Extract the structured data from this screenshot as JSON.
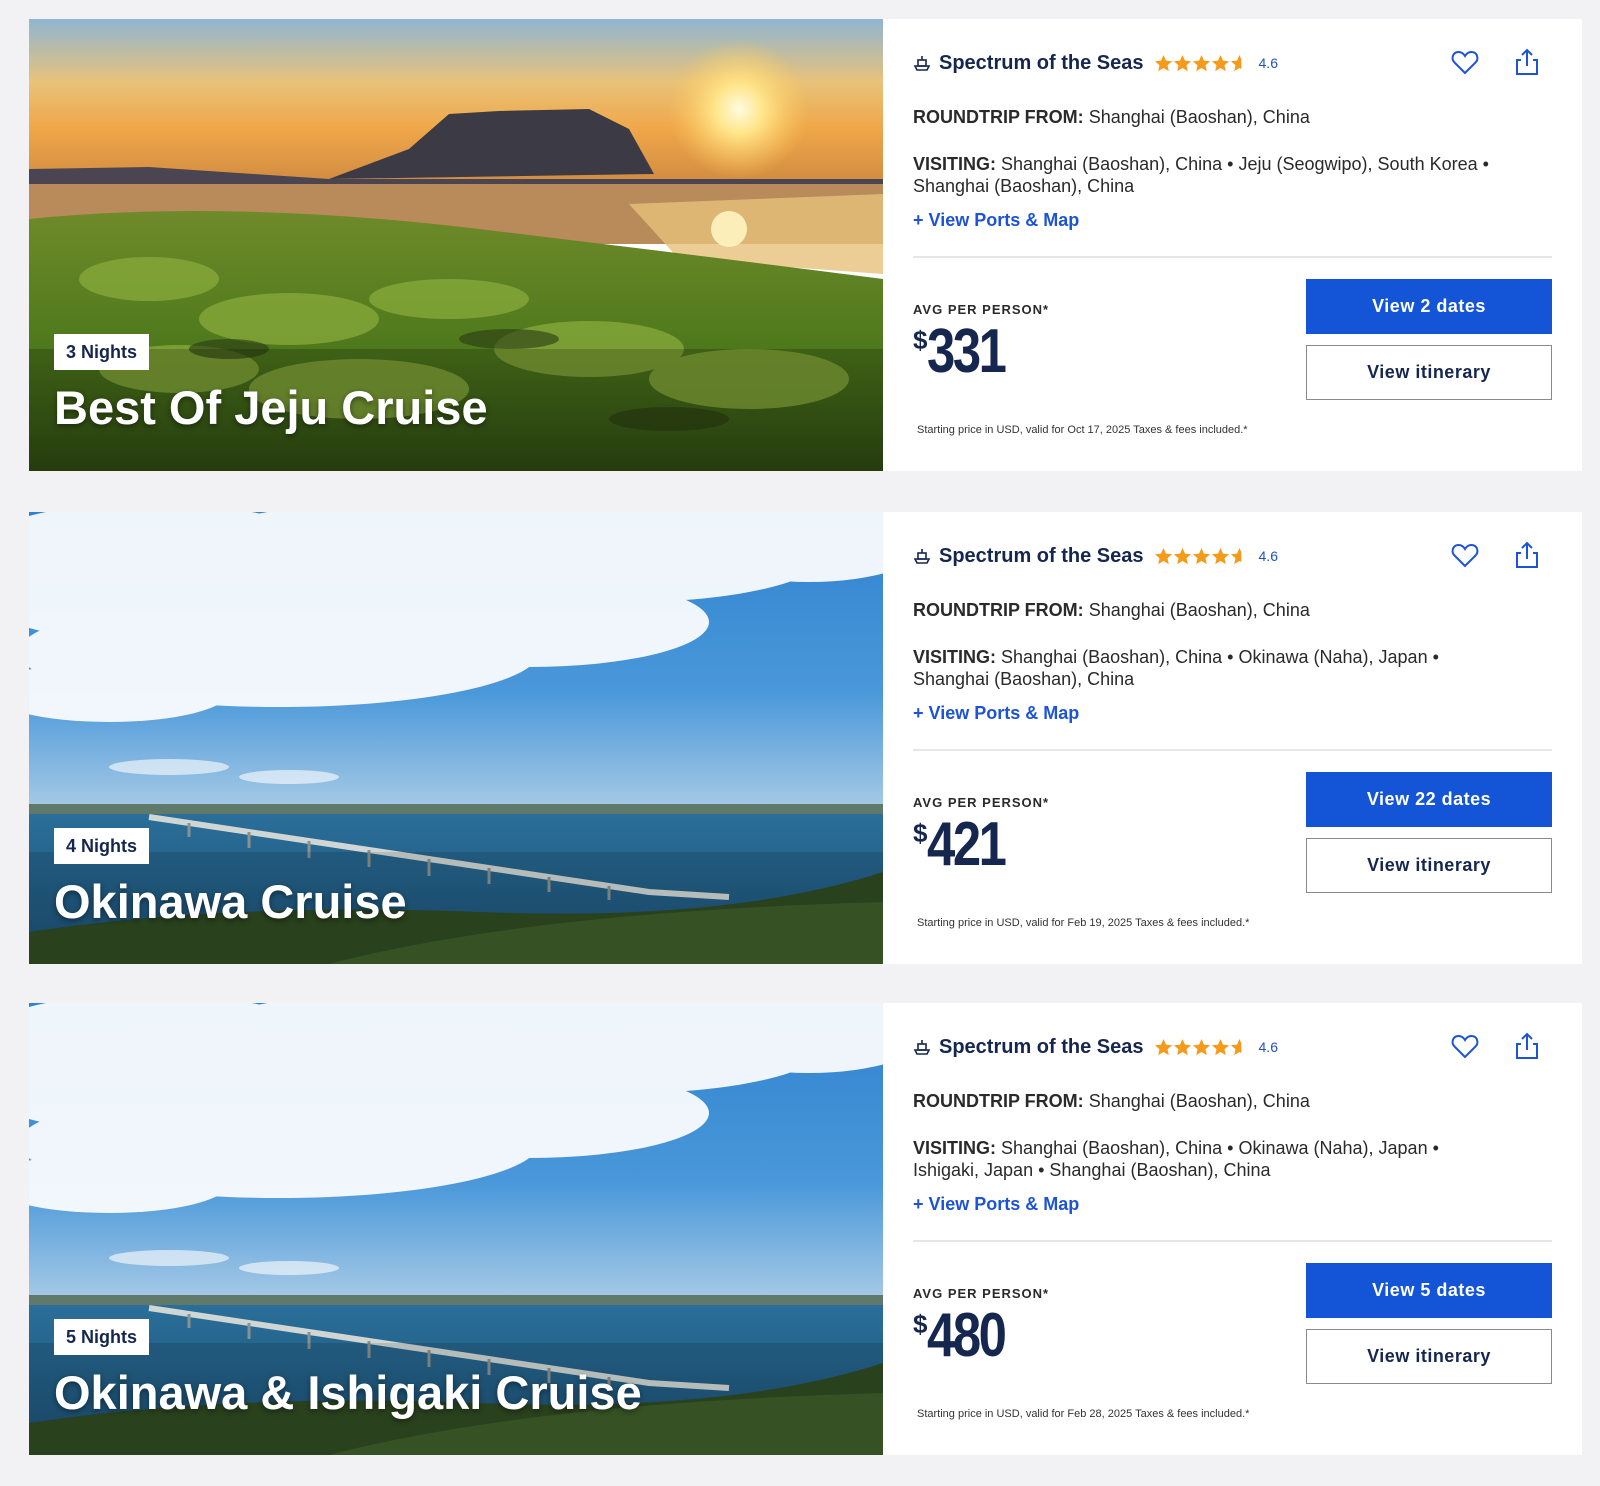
{
  "colors": {
    "brand_navy": "#15264f",
    "primary_blue": "#1455d8",
    "link_blue": "#1d54d6",
    "star_orange": "#f59b1c"
  },
  "cruises": [
    {
      "nights": "3 Nights",
      "title": "Best Of Jeju Cruise",
      "image": "jeju-sunset-coast",
      "ship": "Spectrum of the Seas",
      "rating": "4.6",
      "stars": 4.6,
      "roundtrip_label": "ROUNDTRIP FROM:",
      "roundtrip_value": "Shanghai (Baoshan), China",
      "visiting_label": "VISITING:",
      "visiting_value": "Shanghai (Baoshan), China • Jeju (Seogwipo), South Korea • Shanghai (Baoshan), China",
      "ports_link": "+ View Ports & Map",
      "avg_label": "AVG PER PERSON*",
      "currency": "$",
      "price": "331",
      "price_note": "Starting price in USD, valid for Oct 17, 2025 Taxes & fees included.*",
      "primary_button": "View 2 dates",
      "secondary_button": "View itinerary"
    },
    {
      "nights": "4 Nights",
      "title": "Okinawa Cruise",
      "image": "okinawa-bridge-sea",
      "ship": "Spectrum of the Seas",
      "rating": "4.6",
      "stars": 4.6,
      "roundtrip_label": "ROUNDTRIP FROM:",
      "roundtrip_value": "Shanghai (Baoshan), China",
      "visiting_label": "VISITING:",
      "visiting_value": "Shanghai (Baoshan), China • Okinawa (Naha), Japan • Shanghai (Baoshan), China",
      "ports_link": "+ View Ports & Map",
      "avg_label": "AVG PER PERSON*",
      "currency": "$",
      "price": "421",
      "price_note": "Starting price in USD, valid for Feb 19, 2025 Taxes & fees included.*",
      "primary_button": "View 22 dates",
      "secondary_button": "View itinerary"
    },
    {
      "nights": "5 Nights",
      "title": "Okinawa & Ishigaki Cruise",
      "image": "okinawa-bridge-sea",
      "ship": "Spectrum of the Seas",
      "rating": "4.6",
      "stars": 4.6,
      "roundtrip_label": "ROUNDTRIP FROM:",
      "roundtrip_value": "Shanghai (Baoshan), China",
      "visiting_label": "VISITING:",
      "visiting_value": "Shanghai (Baoshan), China • Okinawa (Naha), Japan • Ishigaki, Japan • Shanghai (Baoshan), China",
      "ports_link": "+ View Ports & Map",
      "avg_label": "AVG PER PERSON*",
      "currency": "$",
      "price": "480",
      "price_note": "Starting price in USD, valid for Feb 28, 2025 Taxes & fees included.*",
      "primary_button": "View 5 dates",
      "secondary_button": "View itinerary"
    }
  ]
}
